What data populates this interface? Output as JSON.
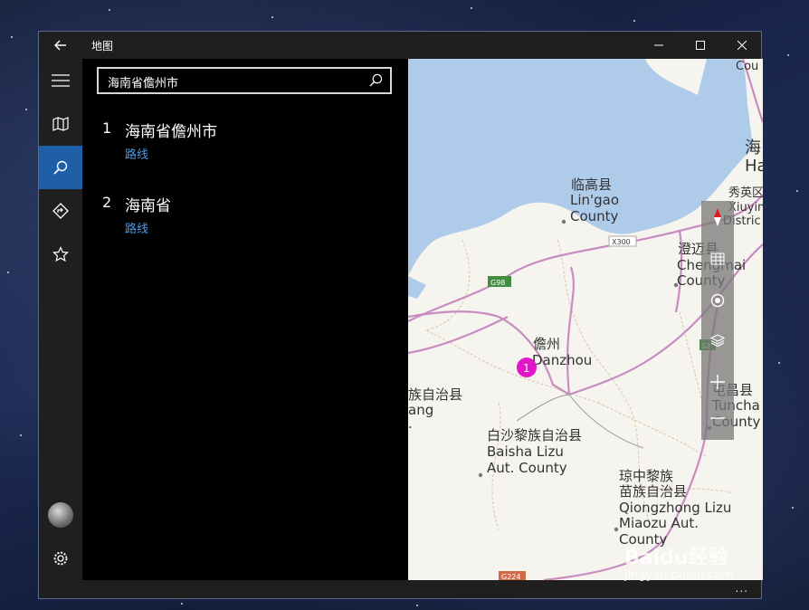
{
  "window": {
    "title": "地图"
  },
  "search": {
    "value": "海南省儋州市"
  },
  "results": [
    {
      "num": "1",
      "name": "海南省儋州市",
      "route": "路线"
    },
    {
      "num": "2",
      "name": "海南省",
      "route": "路线"
    }
  ],
  "map": {
    "labels": {
      "lingao_cn": "临高县",
      "lingao_en1": "Lin'gao",
      "lingao_en2": "County",
      "danzhou_cn": "儋州",
      "danzhou_en": "Danzhou",
      "baisha_cn": "白沙黎族自治县",
      "baisha_en1": "Baisha Lizu",
      "baisha_en2": "Aut. County",
      "qiongzhong_cn1": "琼中黎族",
      "qiongzhong_cn2": "苗族自治县",
      "qiongzhong_en1": "Qiongzhong Lizu",
      "qiongzhong_en2": "Miaozu Aut.",
      "qiongzhong_en3": "County",
      "chengmai_cn": "澄迈县",
      "chengmai_en1": "Chengmai",
      "chengmai_en2": "County",
      "tunchang_cn": "屯昌县",
      "tunchang_en1": "Tuncha",
      "tunchang_en2": "County",
      "xiuying_cn": "秀英区",
      "xiuying_en1": "Xiuying",
      "xiuying_en2": "Distric",
      "haikou_cn": "海",
      "haikou_en": "Ha",
      "cou": "Cou",
      "left_cn": "族自治县",
      "left_en": "ang",
      "left_dot": ".",
      "road_x300": "X300",
      "road_g98": "G98",
      "road_g224": "G224",
      "road_s": "S2"
    },
    "pin": "1"
  },
  "watermark": {
    "brand": "Baidu经验",
    "url": "jingyan.baidu.com"
  },
  "bottom": {
    "more": "..."
  }
}
